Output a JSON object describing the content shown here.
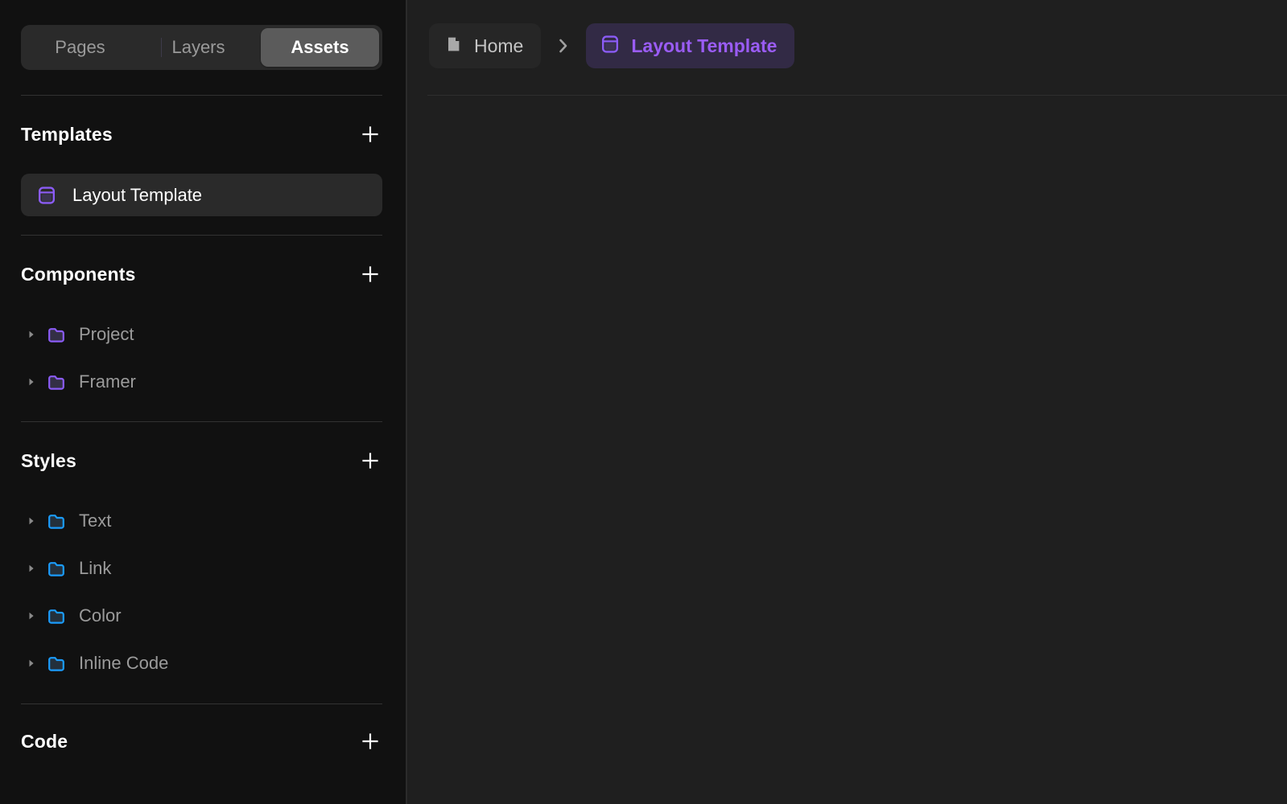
{
  "sidebar": {
    "tabs": [
      {
        "label": "Pages",
        "active": false
      },
      {
        "label": "Layers",
        "active": false
      },
      {
        "label": "Assets",
        "active": true
      }
    ],
    "sections": [
      {
        "title": "Templates",
        "add_label": "+",
        "items": [
          {
            "label": "Layout Template",
            "icon": "template-icon",
            "icon_color": "#8b5cf6",
            "selected": true
          }
        ]
      },
      {
        "title": "Components",
        "add_label": "+",
        "items": [
          {
            "label": "Project",
            "icon": "folder-icon",
            "icon_color": "#8b5cf6",
            "expanded": false
          },
          {
            "label": "Framer",
            "icon": "folder-icon",
            "icon_color": "#8b5cf6",
            "expanded": false
          }
        ]
      },
      {
        "title": "Styles",
        "add_label": "+",
        "items": [
          {
            "label": "Text",
            "icon": "folder-icon",
            "icon_color": "#1b9cfc",
            "expanded": false
          },
          {
            "label": "Link",
            "icon": "folder-icon",
            "icon_color": "#1b9cfc",
            "expanded": false
          },
          {
            "label": "Color",
            "icon": "folder-icon",
            "icon_color": "#1b9cfc",
            "expanded": false
          },
          {
            "label": "Inline Code",
            "icon": "folder-icon",
            "icon_color": "#1b9cfc",
            "expanded": false
          }
        ]
      },
      {
        "title": "Code",
        "add_label": "+",
        "items": []
      }
    ]
  },
  "main": {
    "breadcrumb": [
      {
        "label": "Home",
        "icon": "page-icon",
        "current": false
      },
      {
        "label": "Layout Template",
        "icon": "template-icon",
        "current": true
      }
    ],
    "separator_glyph": "›"
  },
  "colors": {
    "sidebar_bg": "#111111",
    "canvas_bg": "#1f1f1f",
    "selected_row": "#2a2a2a",
    "accent_purple": "#8b5cf6",
    "accent_purple_text": "#9a5cf5",
    "accent_blue": "#1b9cfc",
    "muted_text": "#9b9b9b"
  }
}
